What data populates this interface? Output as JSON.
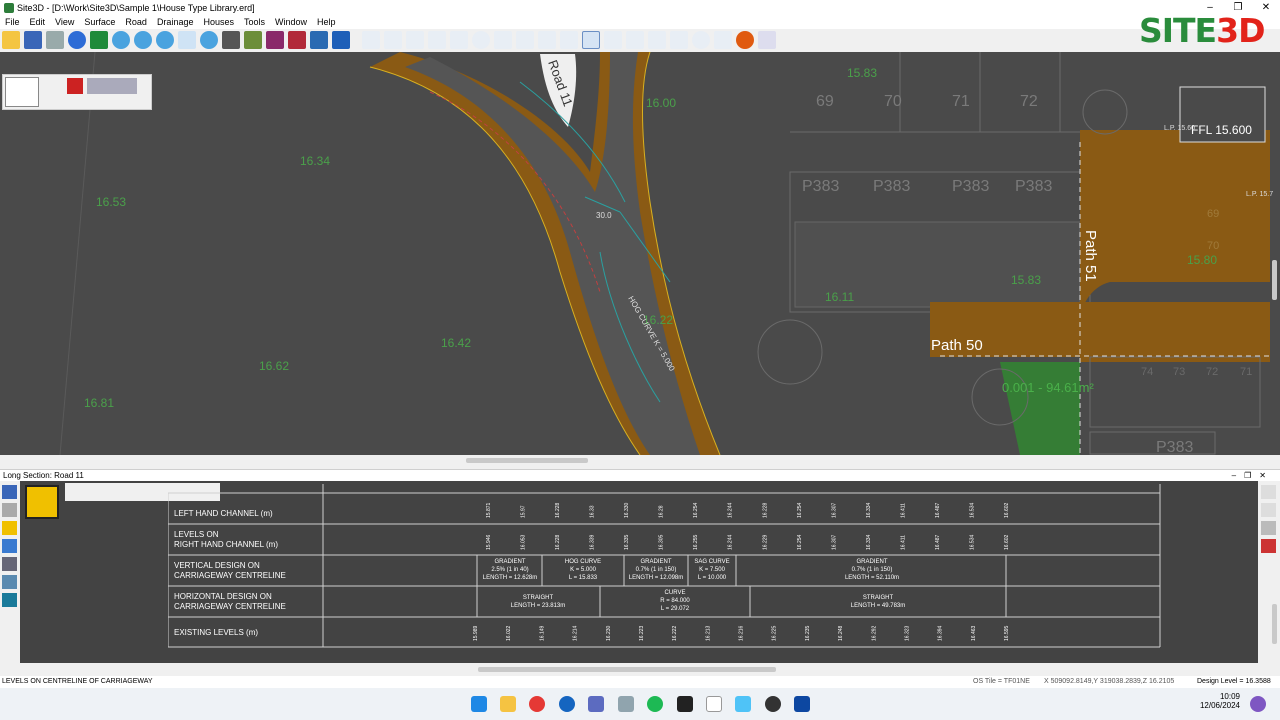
{
  "window": {
    "title": "Site3D - [D:\\Work\\Site3D\\Sample 1\\House Type Library.erd]",
    "controls": [
      "–",
      "❐",
      "✕"
    ]
  },
  "menu": [
    "File",
    "Edit",
    "View",
    "Surface",
    "Road",
    "Drainage",
    "Houses",
    "Tools",
    "Window",
    "Help"
  ],
  "logo": {
    "text_a": "SITE",
    "text_b": "3D",
    "green": "#2a8c3c",
    "red": "#e2231a"
  },
  "plan": {
    "spot_levels": [
      "15.83",
      "16.00",
      "16.34",
      "16.53",
      "16.11",
      "16.42",
      "16.62",
      "16.81",
      "15.83",
      "15.80",
      "16.22"
    ],
    "plots": [
      "69",
      "70",
      "71",
      "72"
    ],
    "plot_types": [
      "P383",
      "P383",
      "P383",
      "P383",
      "P383"
    ],
    "road_label": "Road 11",
    "path51": "Path 51",
    "path50": "Path 50",
    "ffl": "FFL 15.600",
    "lp1": "L.P. 15.60",
    "lp2": "L.P. 15.7",
    "area_label": "0.001 - 94.61m²",
    "curve_label": "HOG CURVE K = 5.000",
    "dim_label": "30.0",
    "small_plots": [
      "74",
      "73",
      "72",
      "71",
      "69",
      "70"
    ]
  },
  "long_section": {
    "panel_title": "Long Section: Road 11",
    "rows": [
      {
        "label1": "LEVELS ON",
        "label2": "LEFT HAND CHANNEL (m)"
      },
      {
        "label1": "LEVELS ON",
        "label2": "RIGHT HAND CHANNEL (m)"
      },
      {
        "label1": "VERTICAL DESIGN ON",
        "label2": "CARRIAGEWAY CENTRELINE"
      },
      {
        "label1": "HORIZONTAL DESIGN ON",
        "label2": "CARRIAGEWAY CENTRELINE"
      },
      {
        "label1": "EXISTING LEVELS (m)",
        "label2": ""
      }
    ],
    "vertical_segments": [
      {
        "l1": "GRADIENT",
        "l2": "2.5% (1 in 40)",
        "l3": "LENGTH = 12.628m"
      },
      {
        "l1": "HOG CURVE",
        "l2": "K = 5.000",
        "l3": "L = 15.833"
      },
      {
        "l1": "GRADIENT",
        "l2": "0.7% (1 in 150)",
        "l3": "LENGTH = 12.098m"
      },
      {
        "l1": "SAG CURVE",
        "l2": "K = 7.500",
        "l3": "L = 10.000"
      },
      {
        "l1": "GRADIENT",
        "l2": "0.7% (1 in 150)",
        "l3": "LENGTH = 52.110m"
      }
    ],
    "horizontal_segments": [
      {
        "l1": "STRAIGHT",
        "l2": "LENGTH = 23.813m",
        "l3": ""
      },
      {
        "l1": "CURVE",
        "l2": "R = 84.000",
        "l3": "L = 29.072"
      },
      {
        "l1": "STRAIGHT",
        "l2": "LENGTH = 49.783m",
        "l3": ""
      }
    ],
    "lh_values": [
      "15.871",
      "15.97",
      "16.228",
      "16.33",
      "16.330",
      "16.28",
      "16.254",
      "16.244",
      "16.228",
      "16.254",
      "16.307",
      "16.334",
      "16.411",
      "16.487",
      "16.534",
      "16.602"
    ],
    "rh_values": [
      "15.946",
      "16.053",
      "16.228",
      "16.339",
      "16.335",
      "16.305",
      "16.255",
      "16.244",
      "16.229",
      "16.254",
      "16.307",
      "16.334",
      "16.411",
      "16.487",
      "16.534",
      "16.602"
    ],
    "existing_values": [
      "15.989",
      "16.022",
      "16.149",
      "16.214",
      "16.230",
      "16.223",
      "16.222",
      "16.213",
      "16.216",
      "16.225",
      "16.235",
      "16.248",
      "16.292",
      "16.323",
      "16.394",
      "16.463",
      "16.595"
    ]
  },
  "status": {
    "left": "LEVELS ON CENTRELINE OF CARRIAGEWAY",
    "os_tile": "OS Tile = TF01NE",
    "coords": "X 509092.8149,Y 319038.2839,Z 16.2105",
    "design_level": "Design Level = 16.3588"
  },
  "clock": {
    "time": "10:09",
    "date": "12/06/2024"
  }
}
